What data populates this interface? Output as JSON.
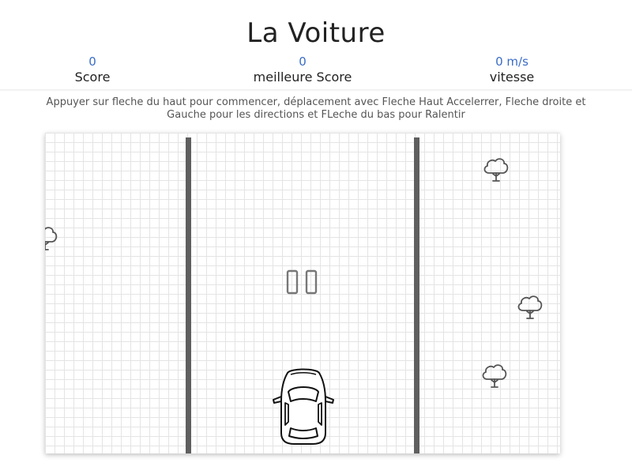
{
  "header": {
    "title": "La Voiture"
  },
  "stats": {
    "score_value": "0",
    "score_label": "Score",
    "best_value": "0",
    "best_label": "meilleure Score",
    "speed_value": "0 m/s",
    "speed_label": "vitesse"
  },
  "instructions": {
    "line1": "Appuyer sur fleche du haut pour commencer, déplacement avec Fleche Haut Accelerrer, Fleche droite et",
    "line2": "Gauche pour les directions et FLeche du bas pour Ralentir"
  },
  "game": {
    "icons": [
      "tree-icon",
      "pause-icon",
      "car-icon"
    ],
    "colors": {
      "value_text": "#3a6cc7",
      "road_line": "#5f5f5f",
      "grid": "#e4e4e4",
      "icon_stroke": "#555555"
    }
  }
}
